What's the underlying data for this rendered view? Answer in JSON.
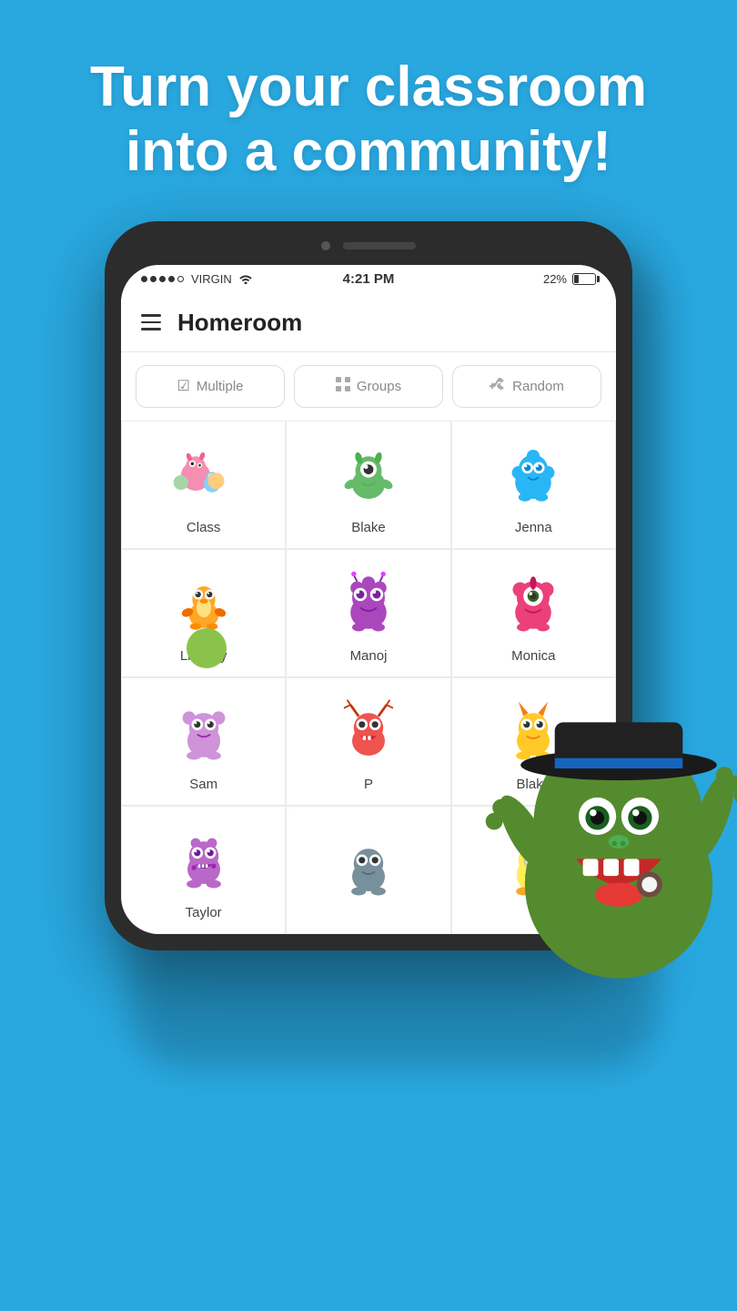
{
  "page": {
    "background_color": "#29a8e0"
  },
  "hero": {
    "title": "Turn your classroom into a community!"
  },
  "status_bar": {
    "carrier": "VIRGIN",
    "time": "4:21 PM",
    "battery_percent": "22%"
  },
  "app": {
    "title": "Homeroom"
  },
  "actions": [
    {
      "id": "multiple",
      "label": "Multiple",
      "icon": "☑"
    },
    {
      "id": "groups",
      "label": "Groups",
      "icon": "⊞"
    },
    {
      "id": "random",
      "label": "Random",
      "icon": "⇄"
    }
  ],
  "students": [
    {
      "id": "class",
      "name": "Class",
      "color": "#ff9eb5"
    },
    {
      "id": "blake1",
      "name": "Blake",
      "color": "#66bb6a"
    },
    {
      "id": "jenna",
      "name": "Jenna",
      "color": "#29b6f6"
    },
    {
      "id": "lindsay",
      "name": "Lindsay",
      "color": "#ffa726"
    },
    {
      "id": "manoj",
      "name": "Manoj",
      "color": "#ab47bc"
    },
    {
      "id": "monica",
      "name": "Monica",
      "color": "#ec407a"
    },
    {
      "id": "sam",
      "name": "Sam",
      "color": "#ce93d8"
    },
    {
      "id": "p",
      "name": "P",
      "color": "#ef5350"
    },
    {
      "id": "blake2",
      "name": "Blake",
      "color": "#ffca28"
    },
    {
      "id": "taylor",
      "name": "Taylor",
      "color": "#ba68c8"
    },
    {
      "id": "extra1",
      "name": "",
      "color": "#ff7043"
    },
    {
      "id": "extra2",
      "name": "",
      "color": "#26c6da"
    }
  ]
}
